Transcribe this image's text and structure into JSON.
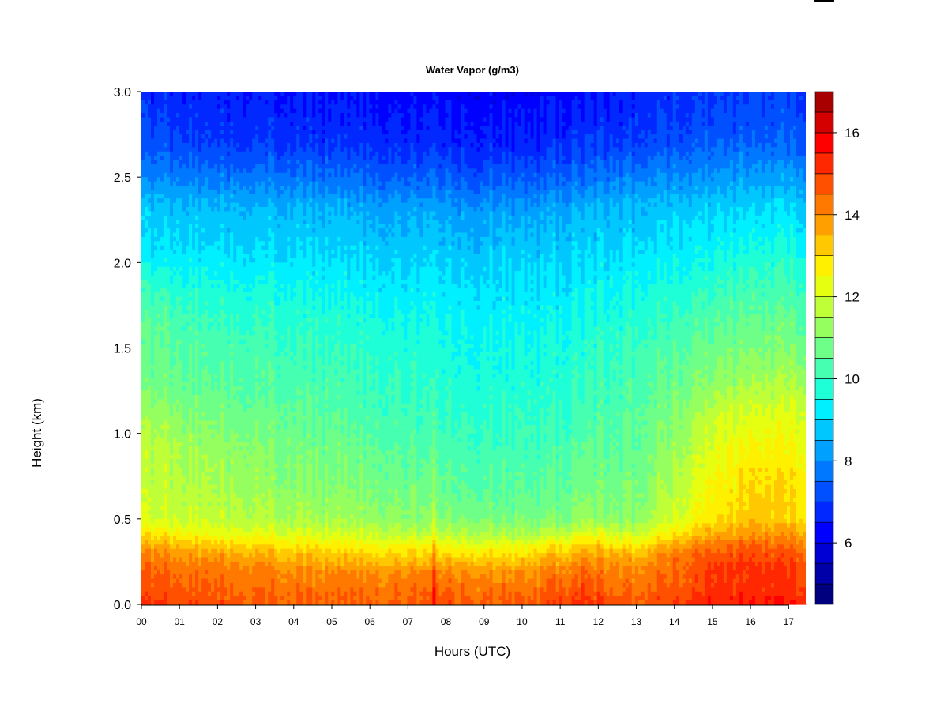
{
  "chart_data": {
    "type": "heatmap",
    "title": "Water Vapor (g/m3)",
    "xlabel": "Hours (UTC)",
    "ylabel": "Height (km)",
    "xlim": [
      0,
      17.45
    ],
    "ylim": [
      0,
      3.0
    ],
    "x_ticks": [
      0,
      1,
      2,
      3,
      4,
      5,
      6,
      7,
      8,
      9,
      10,
      11,
      12,
      13,
      14,
      15,
      16,
      17
    ],
    "x_tick_labels": [
      "00",
      "01",
      "02",
      "03",
      "04",
      "05",
      "06",
      "07",
      "08",
      "09",
      "10",
      "11",
      "12",
      "13",
      "14",
      "15",
      "16",
      "17"
    ],
    "y_ticks": [
      0.0,
      0.5,
      1.0,
      1.5,
      2.0,
      2.5,
      3.0
    ],
    "y_tick_labels": [
      "0.0",
      "0.5",
      "1.0",
      "1.5",
      "2.0",
      "2.5",
      "3.0"
    ],
    "colorbar": {
      "min": 4.5,
      "max": 17,
      "step": 0.5,
      "tick_values": [
        6,
        8,
        10,
        12,
        14,
        16
      ],
      "tick_labels": [
        "6",
        "8",
        "10",
        "12",
        "14",
        "16"
      ],
      "colors": [
        "#00007f",
        "#0000a8",
        "#0000d4",
        "#0000ff",
        "#0028ff",
        "#0050ff",
        "#0078ff",
        "#00a0ff",
        "#00c8ff",
        "#00f0ff",
        "#1effd8",
        "#46ffb0",
        "#6eff88",
        "#96ff60",
        "#beff38",
        "#e6ff10",
        "#fff000",
        "#ffc800",
        "#ffa000",
        "#ff7800",
        "#ff5000",
        "#ff2800",
        "#ff0000",
        "#d40000",
        "#a80000"
      ]
    },
    "profile_height_km": [
      0.0,
      0.1,
      0.2,
      0.3,
      0.4,
      0.5,
      0.7,
      0.9,
      1.1,
      1.3,
      1.5,
      1.7,
      1.9,
      2.1,
      2.3,
      2.5,
      2.7,
      2.9,
      3.0
    ],
    "profiles": [
      {
        "hour": 0.0,
        "values": [
          15.0,
          14.7,
          14.5,
          14.0,
          13.0,
          12.0,
          11.8,
          11.8,
          11.3,
          10.8,
          10.6,
          10.4,
          9.8,
          9.0,
          8.8,
          7.9,
          7.2,
          6.9,
          6.7
        ]
      },
      {
        "hour": 2.0,
        "values": [
          14.8,
          14.5,
          14.3,
          13.7,
          12.5,
          11.8,
          11.5,
          11.3,
          10.9,
          10.5,
          10.3,
          10.0,
          9.5,
          9.0,
          8.7,
          7.8,
          7.0,
          6.7,
          6.6
        ]
      },
      {
        "hour": 4.0,
        "values": [
          14.6,
          14.3,
          14.0,
          13.3,
          12.2,
          11.5,
          11.1,
          10.9,
          10.6,
          10.3,
          10.1,
          9.8,
          9.4,
          8.9,
          8.6,
          7.7,
          6.9,
          6.6,
          6.5
        ]
      },
      {
        "hour": 6.0,
        "values": [
          14.6,
          14.3,
          13.9,
          13.0,
          12.0,
          11.3,
          10.9,
          10.6,
          10.3,
          10.1,
          9.9,
          9.6,
          9.2,
          8.8,
          8.4,
          7.5,
          6.8,
          6.5,
          6.4
        ]
      },
      {
        "hour": 8.0,
        "values": [
          14.8,
          14.4,
          14.0,
          13.0,
          11.8,
          11.0,
          10.6,
          10.3,
          10.0,
          9.8,
          9.6,
          9.4,
          9.1,
          8.7,
          8.3,
          7.4,
          6.7,
          6.4,
          6.2
        ]
      },
      {
        "hour": 10.0,
        "values": [
          14.6,
          14.2,
          13.8,
          12.8,
          11.6,
          10.8,
          10.4,
          10.1,
          9.9,
          9.7,
          9.5,
          9.3,
          9.0,
          8.7,
          8.2,
          7.3,
          6.6,
          6.3,
          6.1
        ]
      },
      {
        "hour": 11.0,
        "values": [
          15.0,
          14.6,
          14.2,
          13.4,
          12.0,
          11.0,
          10.6,
          10.3,
          10.0,
          9.8,
          9.7,
          9.4,
          9.1,
          8.8,
          8.4,
          7.5,
          6.8,
          6.5,
          6.3
        ]
      },
      {
        "hour": 12.0,
        "values": [
          15.0,
          14.6,
          14.2,
          13.6,
          12.4,
          11.2,
          10.8,
          10.6,
          10.3,
          10.1,
          9.9,
          9.6,
          9.3,
          8.9,
          8.6,
          7.7,
          6.9,
          6.6,
          6.5
        ]
      },
      {
        "hour": 13.0,
        "values": [
          14.7,
          14.3,
          14.1,
          13.4,
          12.0,
          11.2,
          10.9,
          10.6,
          10.5,
          10.3,
          10.1,
          9.8,
          9.5,
          9.0,
          8.7,
          7.9,
          7.1,
          6.8,
          6.7
        ]
      },
      {
        "hour": 14.0,
        "values": [
          15.0,
          14.6,
          14.4,
          14.2,
          13.0,
          12.0,
          11.6,
          11.3,
          11.0,
          10.7,
          10.4,
          10.0,
          9.6,
          9.2,
          8.8,
          8.0,
          7.2,
          6.9,
          6.8
        ]
      },
      {
        "hour": 15.0,
        "values": [
          15.3,
          15.0,
          15.0,
          14.6,
          13.6,
          12.8,
          12.5,
          12.2,
          11.8,
          11.1,
          10.7,
          10.3,
          9.8,
          9.3,
          8.9,
          8.1,
          7.3,
          7.0,
          6.9
        ]
      },
      {
        "hour": 16.0,
        "values": [
          15.5,
          15.2,
          15.2,
          14.8,
          14.0,
          13.2,
          13.0,
          12.6,
          12.1,
          11.4,
          10.9,
          10.5,
          10.0,
          9.5,
          9.0,
          8.2,
          7.4,
          7.1,
          7.0
        ]
      },
      {
        "hour": 17.45,
        "values": [
          15.4,
          15.1,
          15.0,
          14.6,
          13.8,
          13.0,
          12.9,
          12.5,
          12.2,
          11.5,
          10.9,
          10.5,
          10.0,
          9.5,
          9.0,
          8.2,
          7.4,
          7.1,
          7.0
        ]
      }
    ],
    "spikes": [
      {
        "hour": 7.7,
        "low_km_value_boost": 1.2
      },
      {
        "hour": 11.6,
        "low_km_value_boost": 0.9
      },
      {
        "hour": 14.9,
        "low_km_value_boost": 0.6
      }
    ]
  }
}
